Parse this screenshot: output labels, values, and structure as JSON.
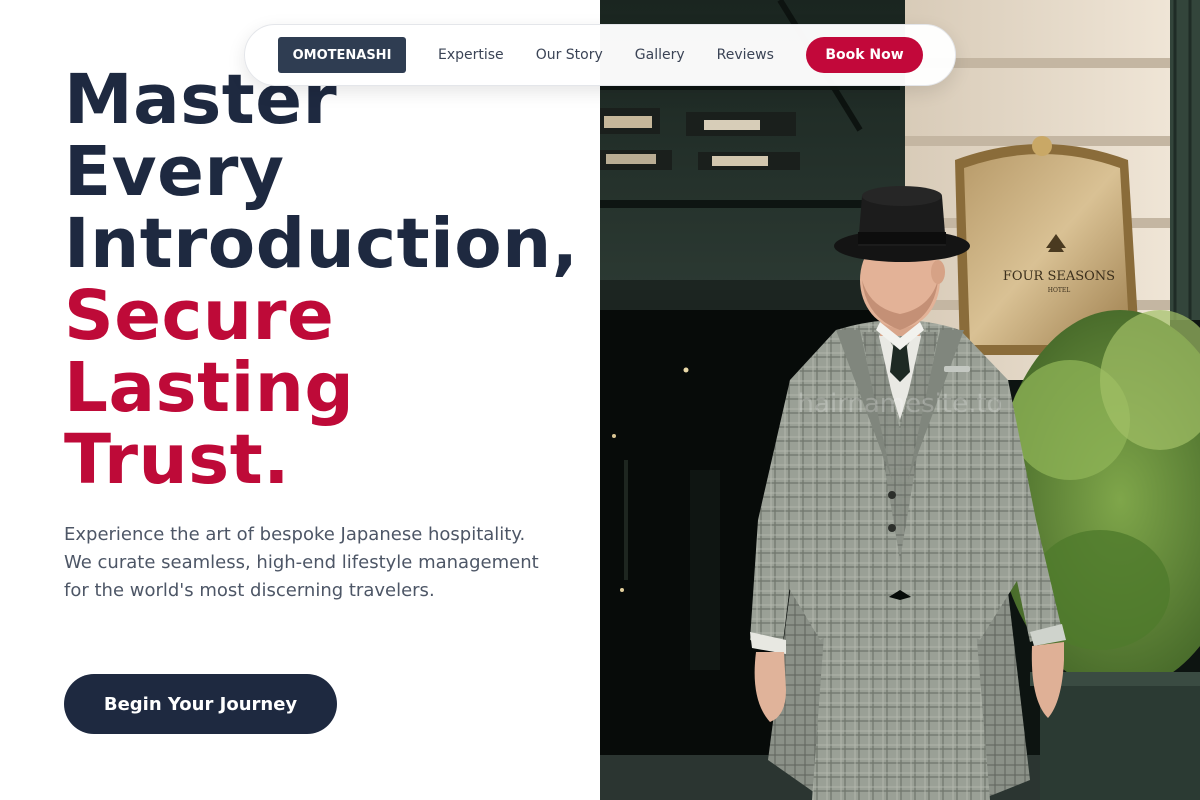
{
  "nav": {
    "logo": "OMOTENASHI",
    "links": [
      "Expertise",
      "Our Story",
      "Gallery",
      "Reviews"
    ],
    "book_label": "Book Now"
  },
  "hero": {
    "title_lines_dark": [
      "Master",
      "Every",
      "Introduction,"
    ],
    "title_lines_accent": [
      "Secure",
      "Lasting",
      "Trust."
    ],
    "description": "Experience the art of bespoke Japanese hospitality. We curate seamless, high-end lifestyle management for the world's most discerning travelers.",
    "cta_label": "Begin Your Journey"
  },
  "photo": {
    "sign_text": "FOUR SEASONS",
    "sign_subtext": "HOTEL",
    "watermark": "hairnamesite.to"
  },
  "colors": {
    "navy": "#1e2940",
    "accent": "#be0a38",
    "book_button": "#c2083a",
    "logo_bg": "#2f3d52",
    "body_text": "#4d5666"
  }
}
